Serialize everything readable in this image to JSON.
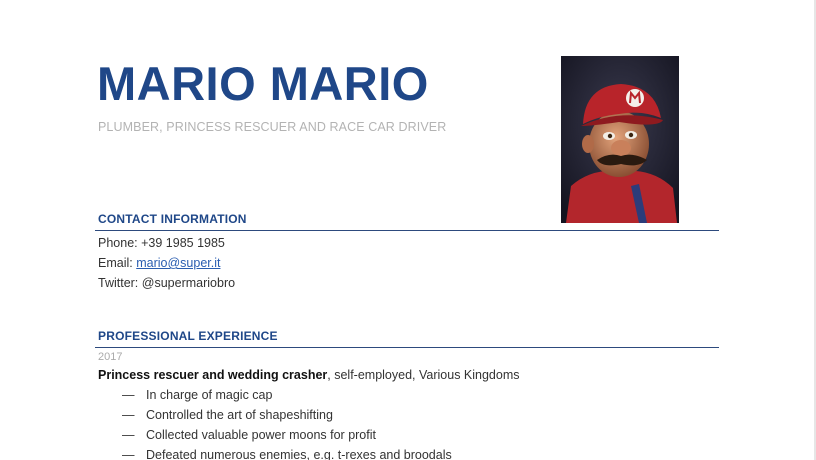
{
  "header": {
    "name": "MARIO MARIO",
    "subtitle": "PLUMBER, PRINCESS RESCUER AND RACE CAR DRIVER"
  },
  "contact": {
    "heading": "CONTACT INFORMATION",
    "phone_label": "Phone:",
    "phone_value": "+39 1985 1985",
    "email_label": "Email:",
    "email_value": "mario@super.it",
    "twitter_label": "Twitter:",
    "twitter_value": "@supermariobro"
  },
  "experience": {
    "heading": "PROFESSIONAL EXPERIENCE",
    "jobs": [
      {
        "year": "2017",
        "title": "Princess rescuer and wedding crasher",
        "details": ", self-employed, Various Kingdoms",
        "bullets": [
          "In charge of magic cap",
          "Controlled the art of shapeshifting",
          "Collected valuable power moons for profit",
          "Defeated numerous enemies, e.g. t-rexes and broodals"
        ]
      }
    ]
  },
  "bullet_marker": "—",
  "colors": {
    "accent": "#1f4788",
    "subtitle": "#b3b3b3",
    "link": "#2a5db0"
  }
}
